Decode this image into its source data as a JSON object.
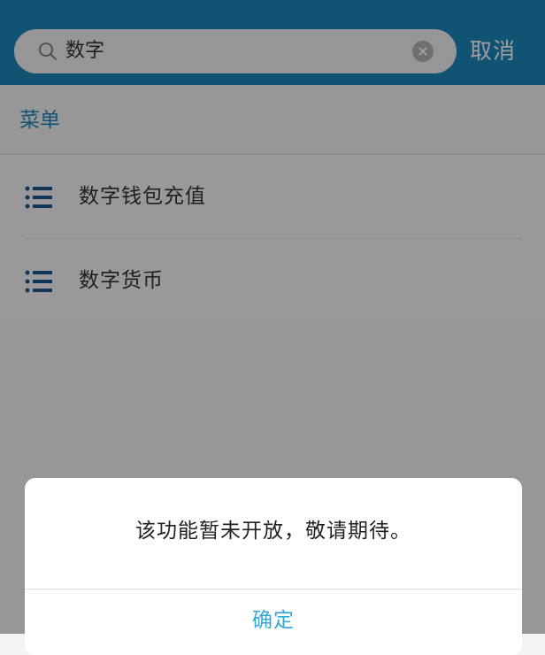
{
  "search": {
    "query": "数字",
    "cancel_label": "取消"
  },
  "section": {
    "label": "菜单"
  },
  "results": [
    {
      "label": "数字钱包充值",
      "icon": "list-icon"
    },
    {
      "label": "数字货币",
      "icon": "list-icon"
    }
  ],
  "dialog": {
    "message": "该功能暂未开放，敬请期待。",
    "confirm_label": "确定"
  },
  "colors": {
    "header": "#1a86b8",
    "accent": "#1c86b8",
    "confirm": "#35a7d5"
  }
}
